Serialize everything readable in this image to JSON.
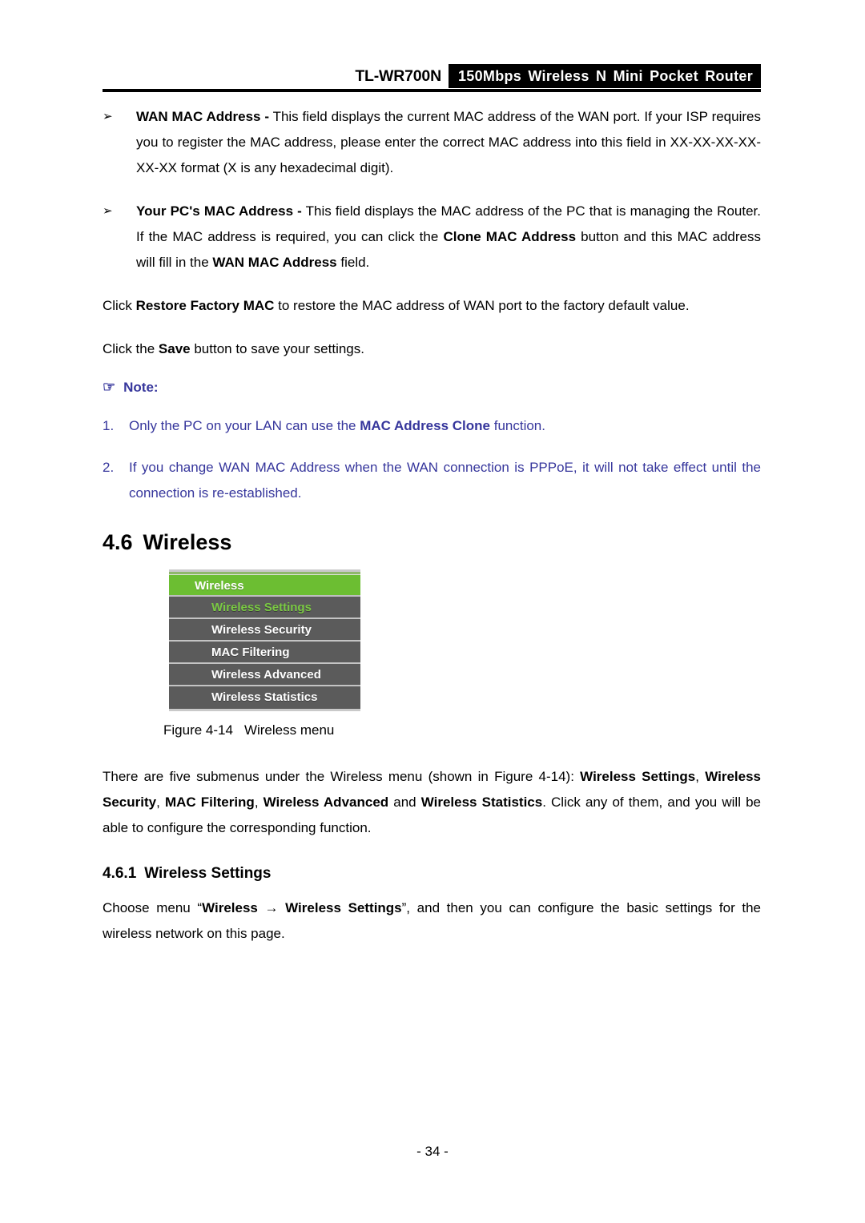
{
  "header": {
    "model": "TL-WR700N",
    "banner": "150Mbps Wireless N Mini Pocket Router"
  },
  "bullets": [
    {
      "marker": "➢",
      "term": "WAN MAC Address -",
      "text": " This field displays the current MAC address of the WAN port. If your ISP requires you to register the MAC address, please enter the correct MAC address into this field in XX-XX-XX-XX-XX-XX format (X is any hexadecimal digit)."
    },
    {
      "marker": "➢",
      "term": "Your PC's MAC Address -",
      "text_1": " This field displays the MAC address of the PC that is managing the Router. If the MAC address is required, you can click the ",
      "bold_1": "Clone MAC Address",
      "text_2": " button and this MAC address will fill in the ",
      "bold_2": "WAN MAC Address",
      "text_3": " field."
    }
  ],
  "paragraphs": {
    "restore_1": "Click ",
    "restore_bold": "Restore Factory MAC",
    "restore_2": " to restore the MAC address of WAN port to the factory default value.",
    "save_1": "Click the ",
    "save_bold": "Save",
    "save_2": " button to save your settings."
  },
  "note": {
    "hand_icon": "pointing-hand-icon",
    "hand_glyph": "☞",
    "title": "Note:",
    "color": "#36369c",
    "items": [
      {
        "number": "1.",
        "text_1": "Only the PC on your LAN can use the ",
        "bold": "MAC Address Clone",
        "text_2": " function."
      },
      {
        "number": "2.",
        "text_1": "If you change WAN MAC Address when the WAN connection is PPPoE, it will not take effect until the connection is re-established.",
        "bold": "",
        "text_2": ""
      }
    ]
  },
  "section": {
    "number": "4.6",
    "title": "Wireless"
  },
  "figure": {
    "menu": {
      "header_label": "Wireless",
      "header_color": "#6cbe32",
      "item_bg_color": "#5b5b5b",
      "active_text_color": "#7ac943",
      "items": [
        {
          "label": "Wireless Settings",
          "active": true
        },
        {
          "label": "Wireless Security",
          "active": false
        },
        {
          "label": "MAC Filtering",
          "active": false
        },
        {
          "label": "Wireless Advanced",
          "active": false
        },
        {
          "label": "Wireless Statistics",
          "active": false
        }
      ]
    },
    "caption_number": "Figure 4-14",
    "caption_text": "Wireless menu"
  },
  "intro": {
    "text_1": "There are five submenus under the Wireless menu (shown in Figure 4-14): ",
    "bold_1": "Wireless Settings",
    "text_2": ", ",
    "bold_2": "Wireless Security",
    "text_3": ", ",
    "bold_3": "MAC Filtering",
    "text_4": ", ",
    "bold_4": "Wireless Advanced",
    "text_5": " and ",
    "bold_5": "Wireless Statistics",
    "text_6": ". Click any of them, and you will be able to configure the corresponding function."
  },
  "subsection": {
    "number": "4.6.1",
    "title": "Wireless Settings"
  },
  "choose": {
    "text_1": "Choose menu “",
    "bold_1": "Wireless",
    "arrow": " → ",
    "bold_2": "Wireless Settings",
    "text_2": "”, and then you can configure the basic settings for the wireless network on this page."
  },
  "footer": {
    "page_label": "- 34 -"
  }
}
